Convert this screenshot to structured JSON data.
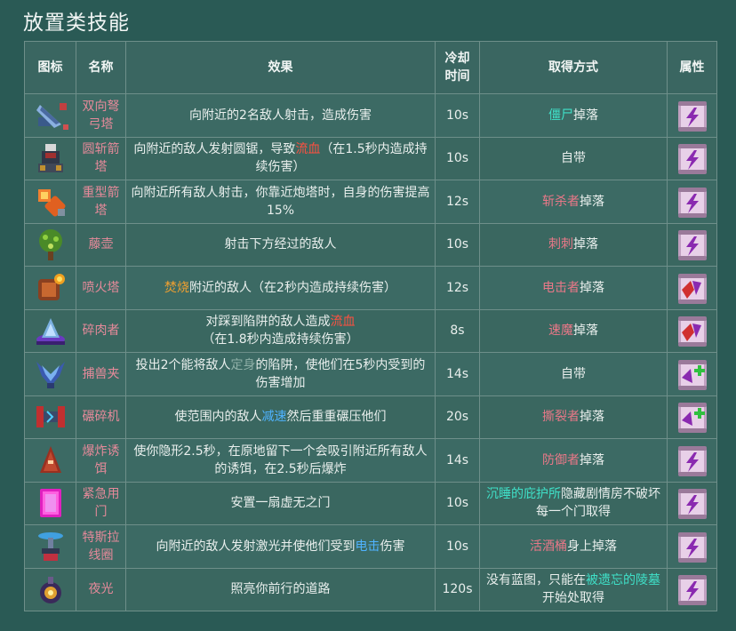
{
  "page_title": "放置类技能",
  "headers": {
    "icon": "图标",
    "name": "名称",
    "effect": "效果",
    "cooldown": "冷却\n时间",
    "obtain": "取得方式",
    "attr": "属性"
  },
  "rows": [
    {
      "icon": "crossbow-tower-icon",
      "name": "双向弩弓塔",
      "effect": [
        {
          "t": "向附近的2名敌人射击，造成伤害"
        }
      ],
      "cooldown": "10s",
      "obtain": [
        {
          "t": "僵尸",
          "c": "cyan"
        },
        {
          "t": "掉落"
        }
      ],
      "attr": "purple-lightning-scroll"
    },
    {
      "icon": "saw-tower-icon",
      "name": "圆斩箭塔",
      "effect": [
        {
          "t": "向附近的敌人发射圆锯，导致"
        },
        {
          "t": "流血",
          "c": "red"
        },
        {
          "t": "（在1.5秒内造成持续伤害）"
        }
      ],
      "cooldown": "10s",
      "obtain": [
        {
          "t": "自带"
        }
      ],
      "attr": "purple-lightning-scroll"
    },
    {
      "icon": "heavy-crossbow-icon",
      "name": "重型箭塔",
      "effect": [
        {
          "t": "向附近所有敌人射击，你靠近炮塔时，自身的伤害提高15%"
        }
      ],
      "cooldown": "12s",
      "obtain": [
        {
          "t": "斩杀者",
          "c": "pink"
        },
        {
          "t": "掉落"
        }
      ],
      "attr": "purple-lightning-scroll"
    },
    {
      "icon": "vine-pot-icon",
      "name": "藤壶",
      "effect": [
        {
          "t": "射击下方经过的敌人"
        }
      ],
      "cooldown": "10s",
      "obtain": [
        {
          "t": "刺刺",
          "c": "pink"
        },
        {
          "t": "掉落"
        }
      ],
      "attr": "purple-lightning-scroll"
    },
    {
      "icon": "flamethrower-tower-icon",
      "name": "喷火塔",
      "effect": [
        {
          "t": "焚烧",
          "c": "orange"
        },
        {
          "t": "附近的敌人（在2秒内造成持续伤害）"
        }
      ],
      "cooldown": "12s",
      "obtain": [
        {
          "t": "电击者",
          "c": "pink"
        },
        {
          "t": "掉落"
        }
      ],
      "attr": "red-purple-scroll"
    },
    {
      "icon": "meat-grinder-icon",
      "name": "碎肉者",
      "effect": [
        {
          "t": "对踩到陷阱的敌人造成"
        },
        {
          "t": "流血",
          "c": "red"
        },
        {
          "t": "（在1.8秒内造成持续伤害）"
        }
      ],
      "cooldown": "8s",
      "obtain": [
        {
          "t": "速魔",
          "c": "pink"
        },
        {
          "t": "掉落"
        }
      ],
      "attr": "red-purple-scroll"
    },
    {
      "icon": "wolf-trap-icon",
      "name": "捕兽夹",
      "effect": [
        {
          "t": "投出2个能将敌人"
        },
        {
          "t": "定身",
          "c": "gray"
        },
        {
          "t": "的陷阱，使他们在5秒内受到的伤害增加"
        }
      ],
      "cooldown": "14s",
      "obtain": [
        {
          "t": "自带"
        }
      ],
      "attr": "purple-green-scroll"
    },
    {
      "icon": "crusher-icon",
      "name": "碾碎机",
      "effect": [
        {
          "t": "使范围内的敌人"
        },
        {
          "t": "减速",
          "c": "blue"
        },
        {
          "t": "然后重重碾压他们"
        }
      ],
      "cooldown": "20s",
      "obtain": [
        {
          "t": "撕裂者",
          "c": "pink"
        },
        {
          "t": "掉落"
        }
      ],
      "attr": "purple-green-scroll"
    },
    {
      "icon": "decoy-icon",
      "name": "爆炸诱饵",
      "effect": [
        {
          "t": "使你隐形2.5秒，在原地留下一个会吸引附近所有敌人的诱饵，在2.5秒后爆炸"
        }
      ],
      "cooldown": "14s",
      "obtain": [
        {
          "t": "防御者",
          "c": "pink"
        },
        {
          "t": "掉落"
        }
      ],
      "attr": "purple-lightning-scroll"
    },
    {
      "icon": "emergency-door-icon",
      "name": "紧急用门",
      "effect": [
        {
          "t": "安置一扇虚无之门"
        }
      ],
      "cooldown": "10s",
      "obtain": [
        {
          "t": "沉睡的庇护所",
          "c": "cyan"
        },
        {
          "t": "隐藏剧情房不破坏每一个门取得"
        }
      ],
      "attr": "purple-lightning-scroll"
    },
    {
      "icon": "tesla-coil-icon",
      "name": "特斯拉线圈",
      "effect": [
        {
          "t": "向附近的敌人发射激光并使他们受到"
        },
        {
          "t": "电击",
          "c": "blue"
        },
        {
          "t": "伤害"
        }
      ],
      "cooldown": "10s",
      "obtain": [
        {
          "t": "活酒桶",
          "c": "pink"
        },
        {
          "t": "身上掉落"
        }
      ],
      "attr": "purple-lightning-scroll"
    },
    {
      "icon": "night-light-icon",
      "name": "夜光",
      "effect": [
        {
          "t": "照亮你前行的道路"
        }
      ],
      "cooldown": "120s",
      "obtain": [
        {
          "t": "没有蓝图，只能在"
        },
        {
          "t": "被遗忘的陵墓",
          "c": "cyan"
        },
        {
          "t": "开始处取得"
        }
      ],
      "attr": "purple-lightning-scroll"
    }
  ]
}
